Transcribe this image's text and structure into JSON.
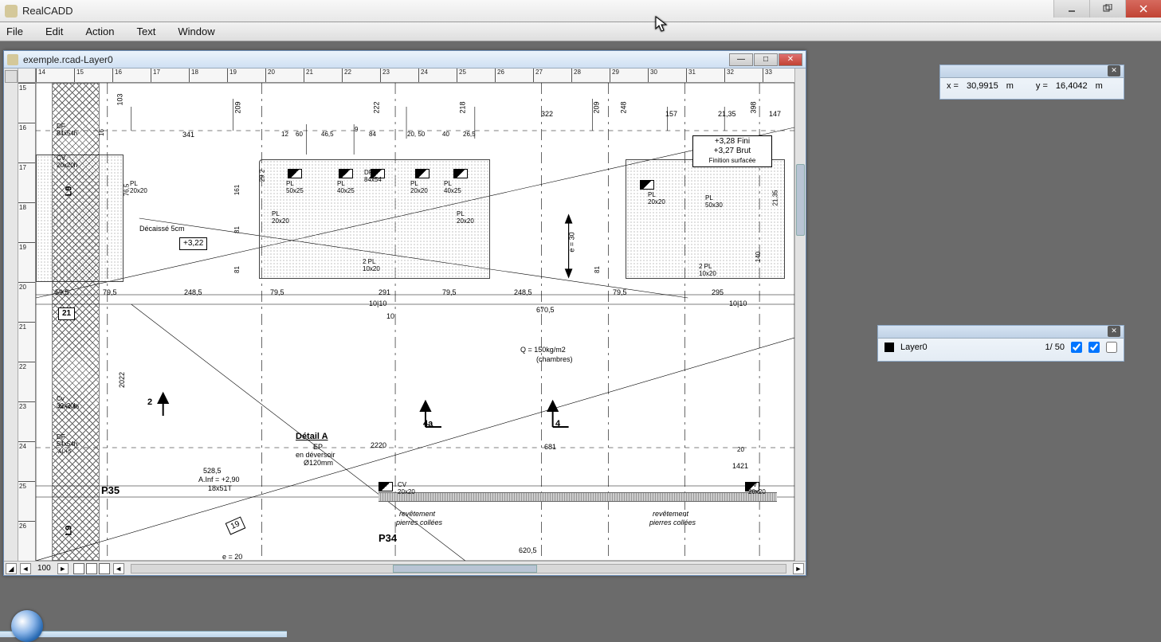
{
  "app": {
    "title": "RealCADD"
  },
  "menu": {
    "file": "File",
    "edit": "Edit",
    "action": "Action",
    "text": "Text",
    "window": "Window"
  },
  "doc": {
    "title": "exemple.rcad-Layer0"
  },
  "status": {
    "zoom": "100",
    "arrow_l": "◄",
    "arrow_r": "►"
  },
  "ruler_h": [
    "14",
    "15",
    "16",
    "17",
    "18",
    "19",
    "20",
    "21",
    "22",
    "23",
    "24",
    "25",
    "26",
    "27",
    "28",
    "29",
    "30",
    "31",
    "32",
    "33"
  ],
  "ruler_v": [
    "15",
    "16",
    "17",
    "18",
    "19",
    "20",
    "21",
    "22",
    "23",
    "24",
    "25",
    "26"
  ],
  "coord": {
    "x_label": "x = ",
    "x_val": "30,9915",
    "x_unit": "m",
    "y_label": "y = ",
    "y_val": "16,4042",
    "y_unit": "m"
  },
  "layer": {
    "name": "Layer0",
    "scale": "1/  50"
  },
  "drawing": {
    "decaisse": "Décaissé 5cm",
    "elev322": "+3,22",
    "fini_l1": "+3,28 Fini",
    "fini_l2": "+3,27 Brut",
    "fini_l3": "Finition surfacée",
    "q_label": "Q = 150kg/m2",
    "q_sub": "(chambres)",
    "epais": "e = 30",
    "detail_a": "Détail A",
    "ep": "EP",
    "ep_sub1": "en déversoir",
    "ep_sub2": "Ø120mm",
    "val_5285": "528,5",
    "a_inf": "A.Inf = +2,90",
    "dim_18x51": "18x51T",
    "p35": "P35",
    "p34": "P34",
    "rev_pierres": "revêtement",
    "rev_pierres2": "pierres collées",
    "mark_2": "2",
    "mark_4a": "4a",
    "mark_4": "4",
    "val_6705": "670,5",
    "val_6205": "620,5",
    "val_2022": "2022",
    "val_2485": "248,5",
    "val_795": "79,5",
    "val_291": "291",
    "val_295": "295",
    "val_681": "681",
    "val_1421": "1421",
    "val_2220": "2220",
    "val_322": "322",
    "val_341": "341",
    "val_222": "222",
    "val_218": "218",
    "val_209": "209",
    "val_248": "248",
    "val_157": "157",
    "val_2135": "21,35",
    "val_398": "398",
    "val_147": "147",
    "val_e20": "e = 20",
    "val_19": "19",
    "val_21": "21",
    "val_L9": "L9",
    "val_10_10": "10|10",
    "val_10": "10",
    "val_103": "103",
    "val_595": "59,5",
    "pl_20x20": "PL\n20x20",
    "pl_50x25": "PL\n50x25",
    "pl_40x25": "PL\n40x25",
    "pl_50x30": "PL\n50x30",
    "df_84x54": "DF\n84x54",
    "cv_20x20": "CV\n20x20",
    "pl2_10x20": "2 PL\n10x20",
    "dim_20_50": "20, 50",
    "dim_40": "40",
    "dim_265": "26,5",
    "dim_465": "46,5",
    "dim_60": "60",
    "dim_12": "12",
    "dim_84": "84",
    "dim_9": "9",
    "cv_30x20": "Cv\n30x20h",
    "df_54x54": "DF\n54x54h",
    "df_84x54h": "DF\n84x54h",
    "cv_20x20h": "CV\n20x20h",
    "ai_265": "AI.+2,65",
    "ai_5": "AI.+5",
    "val_81": "81",
    "val_292": "29 2",
    "val_161": "161",
    "val_765": "76,5",
    "val_16": "16",
    "val_140": "140",
    "val_2135v": "21,35",
    "val_20": "20"
  }
}
